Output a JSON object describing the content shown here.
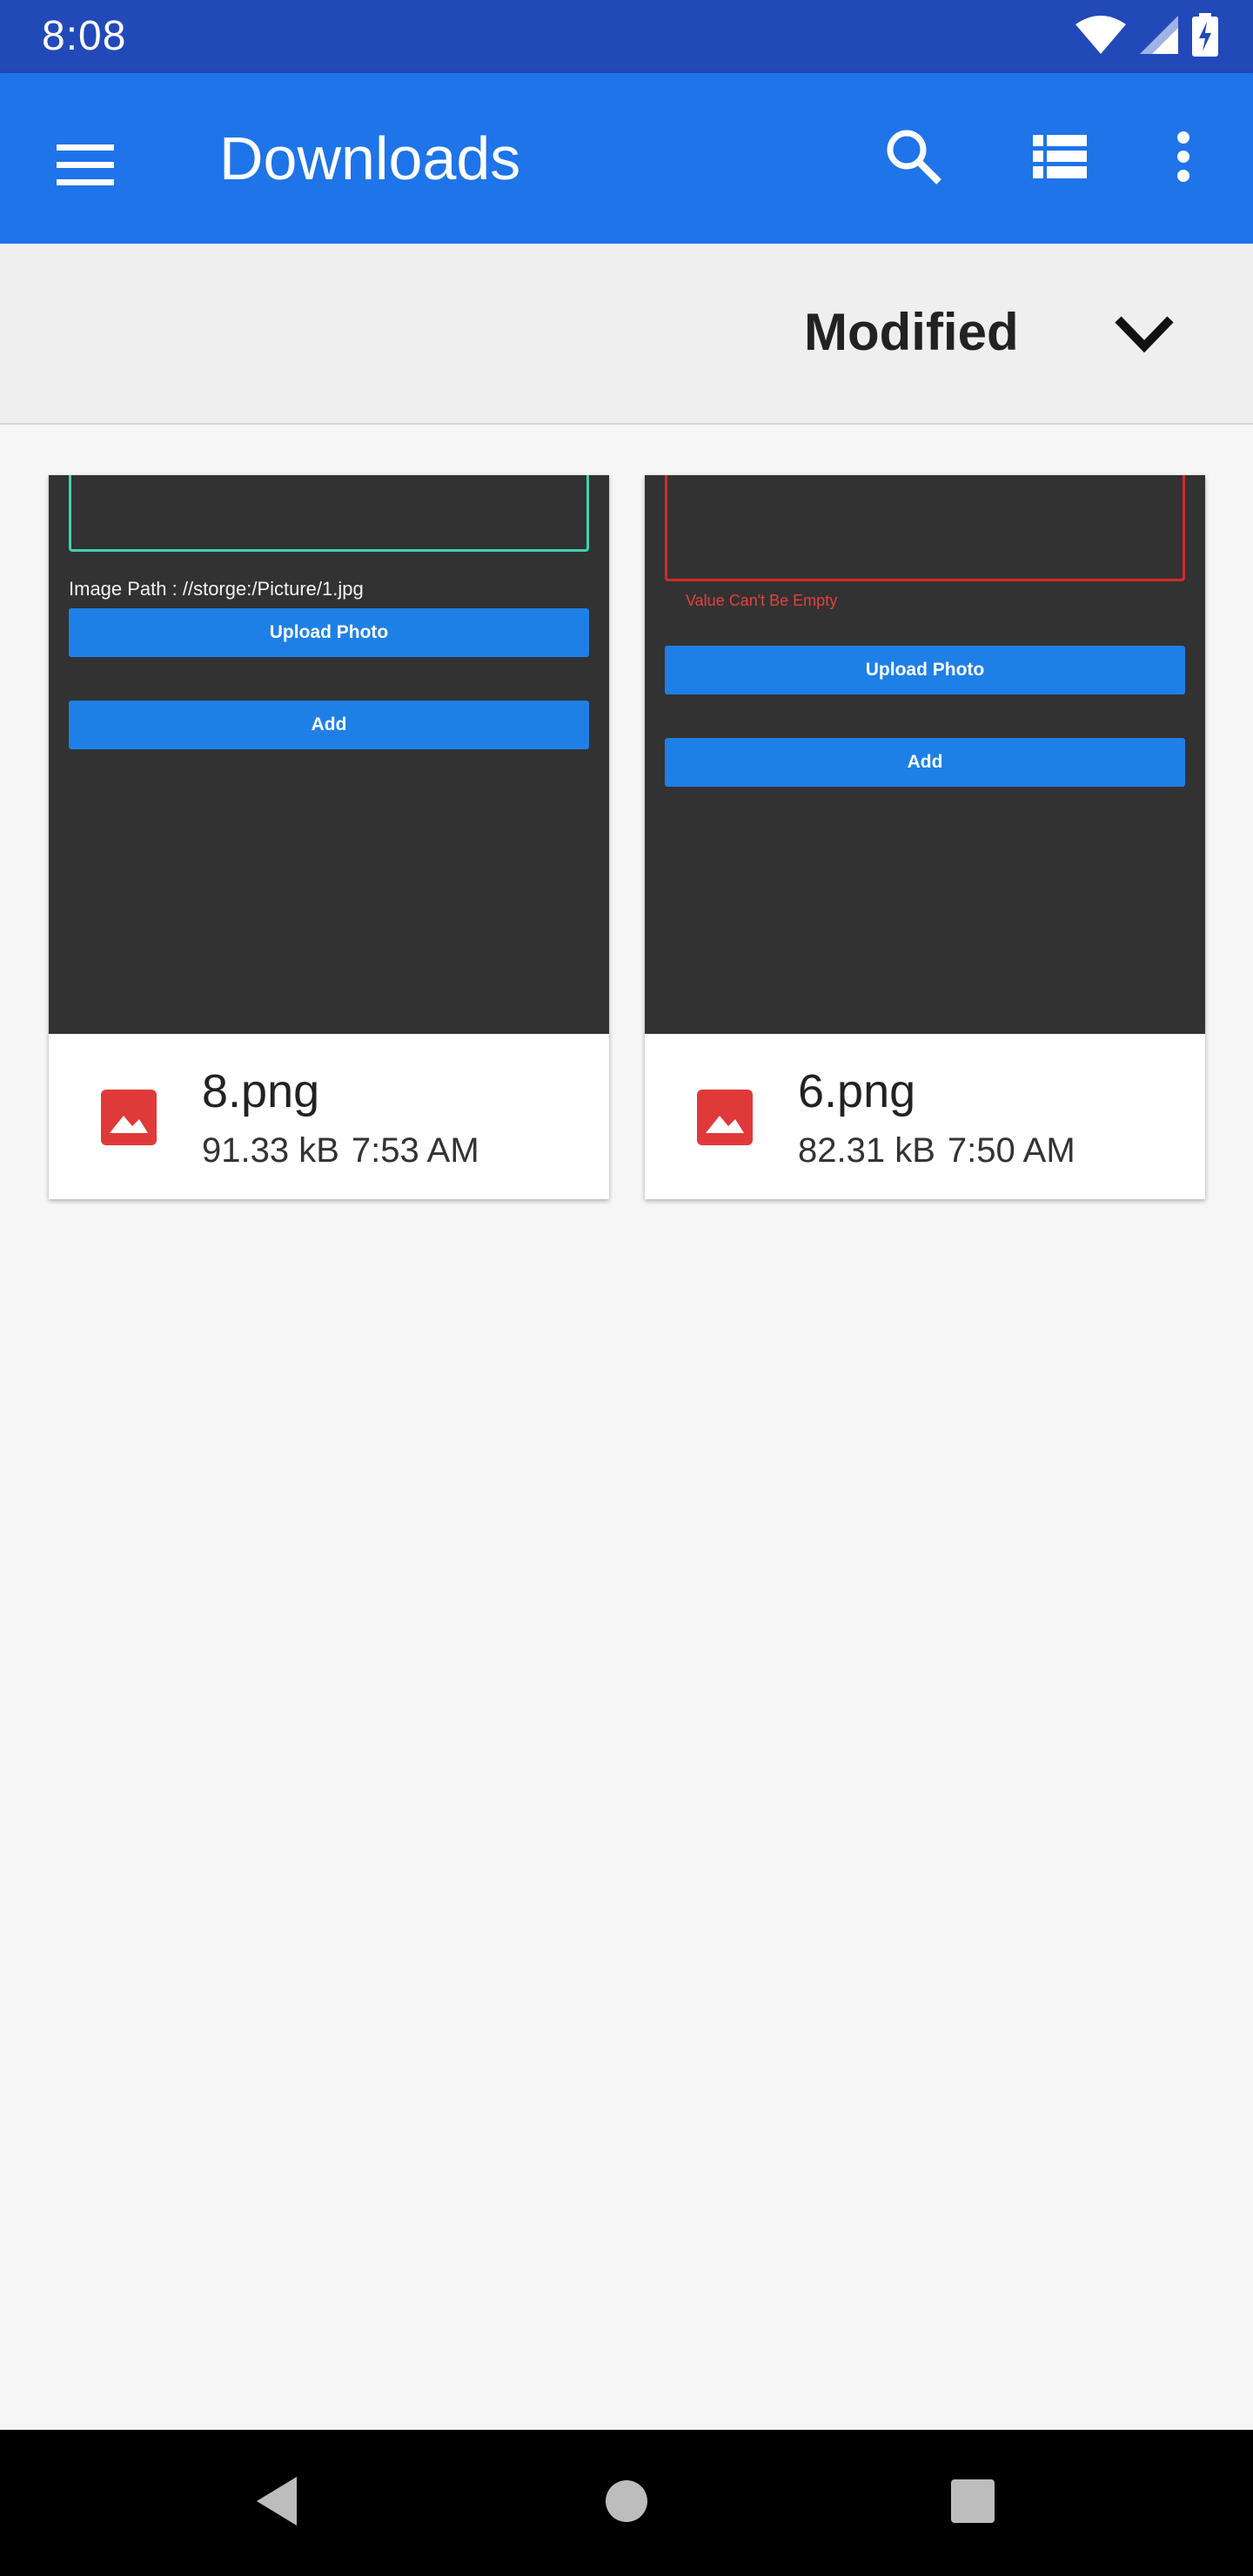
{
  "status_bar": {
    "time": "8:08",
    "icons": [
      "wifi-icon",
      "signal-icon",
      "battery-charging-icon"
    ]
  },
  "app_bar": {
    "title": "Downloads",
    "icons": [
      "menu-icon",
      "search-icon",
      "list-view-icon",
      "more-vert-icon"
    ],
    "color": "#1e74e8"
  },
  "sort": {
    "label": "Modified",
    "icon": "chevron-down-icon"
  },
  "files": [
    {
      "name": "8.png",
      "size": "91.33 kB",
      "time": "7:53 AM",
      "icon": "image-icon",
      "preview": {
        "path_text": "Image Path : //storge:/Picture/1.jpg",
        "buttons": [
          "Upload Photo",
          "Add"
        ]
      }
    },
    {
      "name": "6.png",
      "size": "82.31 kB",
      "time": "7:50 AM",
      "icon": "image-icon",
      "preview": {
        "error_text": "Value Can't Be Empty",
        "buttons": [
          "Upload Photo",
          "Add"
        ]
      }
    }
  ],
  "nav_bar": {
    "icons": [
      "back-icon",
      "home-icon",
      "recents-icon"
    ]
  },
  "colors": {
    "accent": "#1e74e8",
    "status_bar": "#2249b8",
    "file_icon": "#e0393a"
  }
}
